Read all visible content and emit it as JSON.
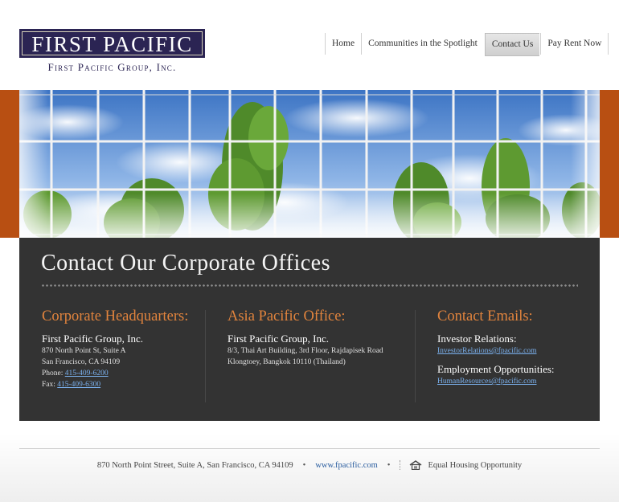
{
  "brand": {
    "logo_text": "FIRST PACIFIC",
    "logo_subtitle": "First Pacific Group, Inc."
  },
  "nav": {
    "items": [
      {
        "label": "Home"
      },
      {
        "label": "Communities in the Spotlight"
      },
      {
        "label": "Contact Us",
        "active": true
      },
      {
        "label": "Pay Rent Now"
      }
    ]
  },
  "main": {
    "title": "Contact Our Corporate Offices",
    "headquarters": {
      "heading": "Corporate Headquarters:",
      "company": "First Pacific Group, Inc.",
      "address1": "870 North Point St, Suite A",
      "address2": "San Francisco, CA 94109",
      "phone_label": "Phone:",
      "phone": "415-409-6200",
      "fax_label": "Fax:",
      "fax": "415-409-6300"
    },
    "asia": {
      "heading": "Asia Pacific Office:",
      "company": "First Pacific Group, Inc.",
      "address1": "8/3, Thai Art Building, 3rd Floor, Rajdapisek Road",
      "address2": "Klongtoey, Bangkok 10110 (Thailand)"
    },
    "emails": {
      "heading": "Contact Emails:",
      "investor_label": "Investor Relations:",
      "investor_email": "InvestorRelations@fpacific.com",
      "hr_label": "Employment Opportunities:",
      "hr_email": "HumanResources@fpacific.com"
    }
  },
  "footer": {
    "address": "870 North Point Street, Suite A, San Francisco, CA 94109",
    "website": "www.fpacific.com",
    "housing": "Equal Housing Opportunity",
    "bullet": "•"
  },
  "colors": {
    "accent_orange": "#b84f12",
    "heading_orange": "#e2843d",
    "panel": "#333333",
    "logo_navy": "#2b2453"
  }
}
